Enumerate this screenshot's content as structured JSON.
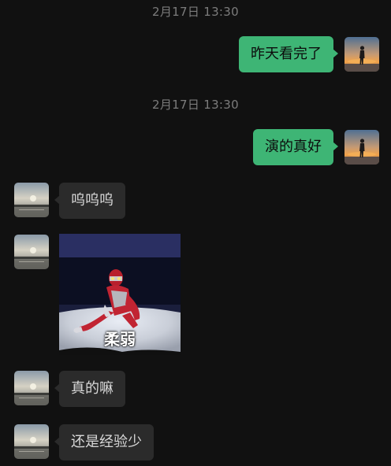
{
  "messages": [
    {
      "type": "timestamp",
      "text": "2月17日 13:30"
    },
    {
      "type": "text",
      "side": "me",
      "text": "昨天看完了",
      "avatar": "sunset-silhouette-avatar"
    },
    {
      "type": "timestamp",
      "text": "2月17日 13:30"
    },
    {
      "type": "text",
      "side": "me",
      "text": "演的真好",
      "avatar": "sunset-silhouette-avatar"
    },
    {
      "type": "text",
      "side": "them",
      "text": "呜呜呜",
      "avatar": "lake-sunset-avatar"
    },
    {
      "type": "sticker",
      "side": "them",
      "caption": "柔弱",
      "avatar": "lake-sunset-avatar",
      "icon": "ultraman-sitting-sticker"
    },
    {
      "type": "text",
      "side": "them",
      "text": "真的嘛",
      "avatar": "lake-sunset-avatar"
    },
    {
      "type": "text",
      "side": "them",
      "text": "还是经验少",
      "avatar": "lake-sunset-avatar"
    }
  ],
  "colors": {
    "background": "#111111",
    "my_bubble": "#3eb575",
    "their_bubble": "#2b2b2b",
    "timestamp": "#7c7c7c"
  }
}
